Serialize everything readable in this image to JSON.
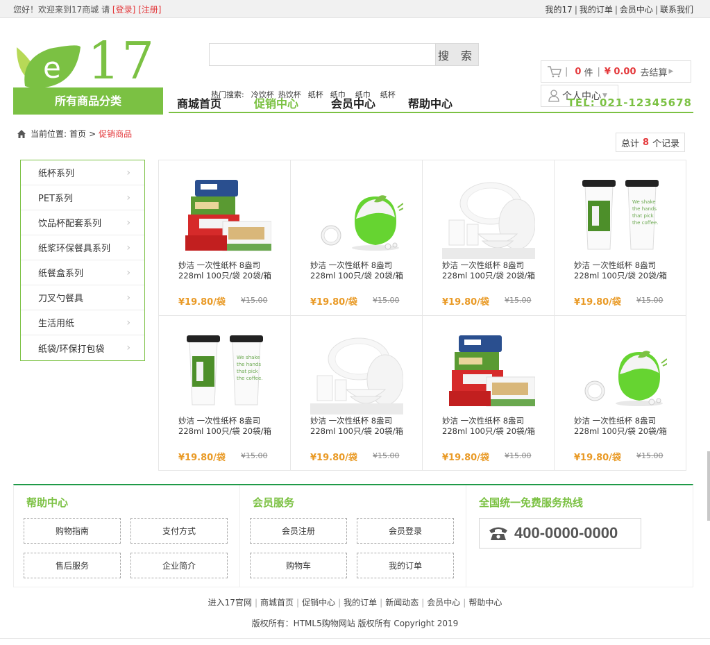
{
  "topbar": {
    "welcome": "您好！欢迎来到17商城 请",
    "login": "[登录]",
    "register": "[注册]",
    "links": [
      "我的17",
      "我的订单",
      "会员中心",
      "联系我们"
    ]
  },
  "logo": {
    "letter": "e",
    "number": "17"
  },
  "search": {
    "placeholder": "",
    "button": "搜 索"
  },
  "hot": {
    "label": "热门搜索:",
    "terms": [
      "冷饮杯",
      "热饮杯",
      "纸杯",
      "纸巾",
      "纸巾",
      "纸杯"
    ]
  },
  "cart": {
    "count": "0",
    "unit": "件",
    "sep": "|",
    "price": "¥ 0.00",
    "checkout": "去结算"
  },
  "usercenter": {
    "label": "个人中心"
  },
  "nav": {
    "category": "所有商品分类",
    "items": [
      "商城首页",
      "促销中心",
      "会员中心",
      "帮助中心"
    ],
    "active_index": 1,
    "tel": "TEL: 021-12345678"
  },
  "breadcrumb": {
    "prefix": "当前位置:",
    "home": "首页",
    "gt": ">",
    "current": "促销商品"
  },
  "total": {
    "prefix": "总计",
    "count": "8",
    "suffix": "个记录"
  },
  "sidebar": {
    "items": [
      "纸杯系列",
      "PET系列",
      "饮品杯配套系列",
      "纸浆环保餐具系列",
      "纸餐盒系列",
      "刀叉勺餐具",
      "生活用纸",
      "纸袋/环保打包袋"
    ]
  },
  "products": [
    {
      "image": "lunchbox-stack",
      "name": "妙洁 一次性纸杯 8盎司228ml 100只/袋 20袋/箱",
      "price": "¥19.80/袋",
      "old_price": "¥15.00"
    },
    {
      "image": "green-ball-clock",
      "name": "妙洁 一次性纸杯 8盎司228ml 100只/袋 20袋/箱",
      "price": "¥19.80/袋",
      "old_price": "¥15.00"
    },
    {
      "image": "white-tableware",
      "name": "妙洁 一次性纸杯 8盎司228ml 100只/袋 20袋/箱",
      "price": "¥19.80/袋",
      "old_price": "¥15.00"
    },
    {
      "image": "coffee-cups",
      "name": "妙洁 一次性纸杯 8盎司228ml 100只/袋 20袋/箱",
      "price": "¥19.80/袋",
      "old_price": "¥15.00"
    },
    {
      "image": "coffee-cups",
      "name": "妙洁 一次性纸杯 8盎司228ml 100只/袋 20袋/箱",
      "price": "¥19.80/袋",
      "old_price": "¥15.00"
    },
    {
      "image": "white-tableware",
      "name": "妙洁 一次性纸杯 8盎司228ml 100只/袋 20袋/箱",
      "price": "¥19.80/袋",
      "old_price": "¥15.00"
    },
    {
      "image": "lunchbox-stack",
      "name": "妙洁 一次性纸杯 8盎司228ml 100只/袋 20袋/箱",
      "price": "¥19.80/袋",
      "old_price": "¥15.00"
    },
    {
      "image": "green-ball-clock",
      "name": "妙洁 一次性纸杯 8盎司228ml 100只/袋 20袋/箱",
      "price": "¥19.80/袋",
      "old_price": "¥15.00"
    }
  ],
  "footer": {
    "help": {
      "title": "帮助中心",
      "buttons": [
        "购物指南",
        "支付方式",
        "售后服务",
        "企业简介"
      ]
    },
    "member": {
      "title": "会员服务",
      "buttons": [
        "会员注册",
        "会员登录",
        "购物车",
        "我的订单"
      ]
    },
    "hotline": {
      "title": "全国统一免费服务热线",
      "number": "400-0000-0000"
    },
    "links": [
      "进入17官网",
      "商城首页",
      "促销中心",
      "我的订单",
      "新闻动态",
      "会员中心",
      "帮助中心"
    ],
    "copyright": "版权所有：HTML5购物网站 版权所有 Copyright 2019"
  },
  "colors": {
    "brand_green": "#7bc143",
    "footer_green": "#1f9a48",
    "price_orange": "#e99a26",
    "red": "#e4393c"
  }
}
